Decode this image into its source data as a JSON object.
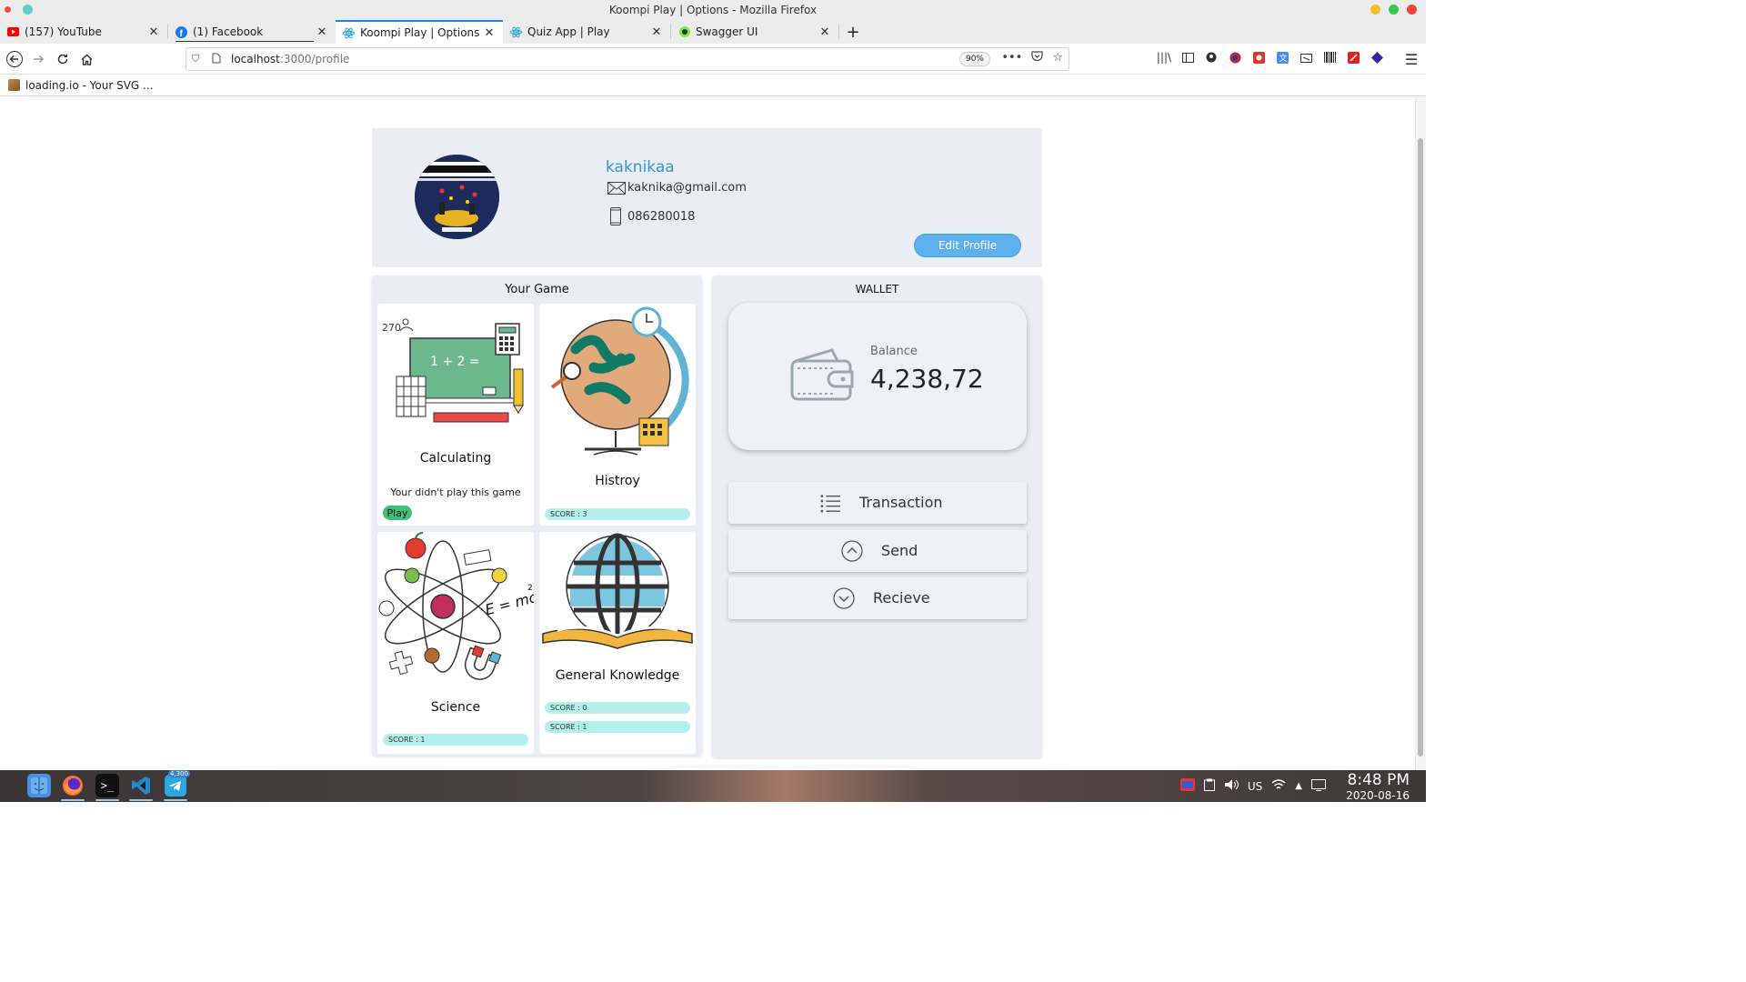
{
  "window": {
    "title": "Koompi Play | Options - Mozilla Firefox"
  },
  "tabs": [
    {
      "label": "(157) YouTube",
      "icon": "youtube-icon",
      "color": "#ff0000"
    },
    {
      "label": "(1) Facebook",
      "icon": "facebook-icon",
      "color": "#1877f2"
    },
    {
      "label": "Koompi Play | Options",
      "icon": "react-icon",
      "color": "#2aa4d8",
      "active": true
    },
    {
      "label": "Quiz App | Play",
      "icon": "react-icon",
      "color": "#2aa4d8"
    },
    {
      "label": "Swagger UI",
      "icon": "swagger-icon",
      "color": "#85ea2d"
    }
  ],
  "tab_close": "✕",
  "new_tab": "+",
  "address": {
    "host": "localhost",
    "path": ":3000/profile",
    "zoom": "90%"
  },
  "bookmarks": [
    {
      "label": "loading.io - Your SVG ..."
    }
  ],
  "profile": {
    "username": "kaknikaa",
    "email": "kaknika@gmail.com",
    "phone": "086280018",
    "edit_label": "Edit Profile"
  },
  "games": {
    "title": "Your Game",
    "items": [
      {
        "name": "Calculating",
        "status": "Your didn't play this game",
        "play_label": "Play"
      },
      {
        "name": "Histroy",
        "scores": [
          "SCORE : 3"
        ]
      },
      {
        "name": "Science",
        "scores": [
          "SCORE : 1"
        ]
      },
      {
        "name": "General Knowledge",
        "scores": [
          "SCORE : 0",
          "SCORE : 1"
        ]
      }
    ]
  },
  "wallet": {
    "title": "WALLET",
    "balance_label": "Balance",
    "balance_value": "4,238,72",
    "actions": [
      {
        "label": "Transaction",
        "icon": "list-icon"
      },
      {
        "label": "Send",
        "icon": "chevron-up-circle-icon"
      },
      {
        "label": "Recieve",
        "icon": "chevron-down-circle-icon"
      }
    ]
  },
  "taskbar": {
    "telegram_badge": "4,300",
    "keyboard": "US",
    "time": "8:48 PM",
    "date": "2020-08-16"
  }
}
